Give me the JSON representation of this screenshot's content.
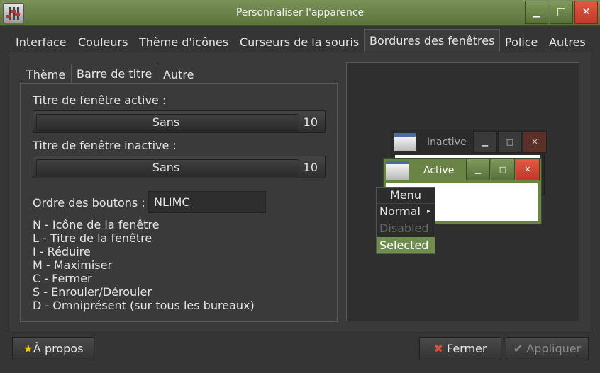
{
  "window": {
    "title": "Personnaliser l'apparence"
  },
  "icons": {
    "app": "settings-sliders-icon",
    "minimize": "minimize-icon",
    "maximize": "maximize-icon",
    "close": "close-icon",
    "about": "star-icon",
    "cancel": "x-icon",
    "apply": "check-icon",
    "submenu": "chevron-right-icon"
  },
  "colors": {
    "accent": "#6c8447",
    "close": "#d9472f",
    "selected": "#6f8e4e"
  },
  "tabs": [
    "Interface",
    "Couleurs",
    "Thème d'icônes",
    "Curseurs de la souris",
    "Bordures des fenêtres",
    "Police",
    "Autres"
  ],
  "active_tab": "Bordures des fenêtres",
  "subtabs": [
    "Thème",
    "Barre de titre",
    "Autre"
  ],
  "active_subtab": "Barre de titre",
  "titlebar_settings": {
    "active_label": "Titre de fenêtre active :",
    "active_font": "Sans",
    "active_size": "10",
    "inactive_label": "Titre de fenêtre inactive :",
    "inactive_font": "Sans",
    "inactive_size": "10",
    "button_order_label": "Ordre des boutons :",
    "button_order_value": "NLIMC",
    "legend": [
      "N - Icône de la fenêtre",
      "L - Titre de la fenêtre",
      "I - Réduire",
      "M - Maximiser",
      "C - Fermer",
      "S - Enrouler/Dérouler",
      "D - Omniprésent (sur tous les bureaux)"
    ]
  },
  "preview": {
    "inactive_title": "Inactive",
    "active_title": "Active",
    "menu_title": "Menu",
    "menu_items": [
      "Normal",
      "Disabled",
      "Selected"
    ]
  },
  "buttons": {
    "about": "À propos",
    "cancel": "Fermer",
    "apply": "Appliquer"
  }
}
